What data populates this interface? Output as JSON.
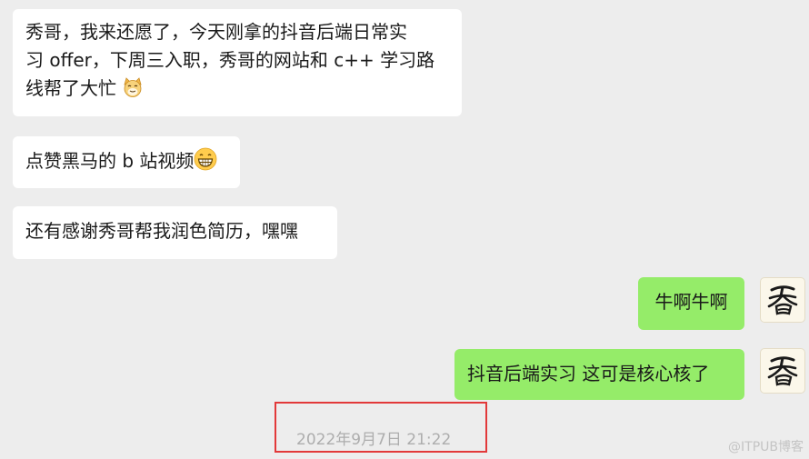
{
  "messages": [
    {
      "line1": "秀哥，我来还愿了，今天刚拿的抖音后端日常实",
      "line2": "习 offer，下周三入职，秀哥的网站和 c++ 学习路",
      "line3": "线帮了大忙",
      "emoji": "cat-face-emoji"
    },
    {
      "text": "点赞黑马的 b 站视频",
      "emoji": "grinning-face-emoji"
    },
    {
      "text": "还有感谢秀哥帮我润色简历，嘿嘿"
    },
    {
      "text": "牛啊牛啊"
    },
    {
      "text": "抖音后端实习 这可是核心核了"
    }
  ],
  "timestamp": "2022年9月7日 21:22",
  "watermark": "@ITPUB博客",
  "colors": {
    "background": "#ededed",
    "incoming": "#ffffff",
    "outgoing": "#95ec69",
    "highlight": "#e2393a"
  }
}
